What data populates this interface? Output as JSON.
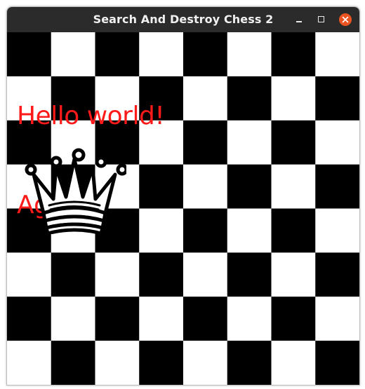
{
  "window": {
    "title": "Search And Destroy Chess 2",
    "controls": [
      "minimize-icon",
      "maximize-icon",
      "close-icon"
    ],
    "close_color": "#e95420",
    "titlebar_color": "#2b2b2b"
  },
  "board": {
    "rows": 8,
    "cols": 8,
    "dark_color": "#000000",
    "light_color": "#ffffff",
    "first_square_dark": true
  },
  "overlay": {
    "line1": "Hello world!",
    "line2": "Ag",
    "color": "#ff1a1a"
  },
  "piece": {
    "type": "queen",
    "color": "white",
    "row": 3,
    "col": 0
  }
}
